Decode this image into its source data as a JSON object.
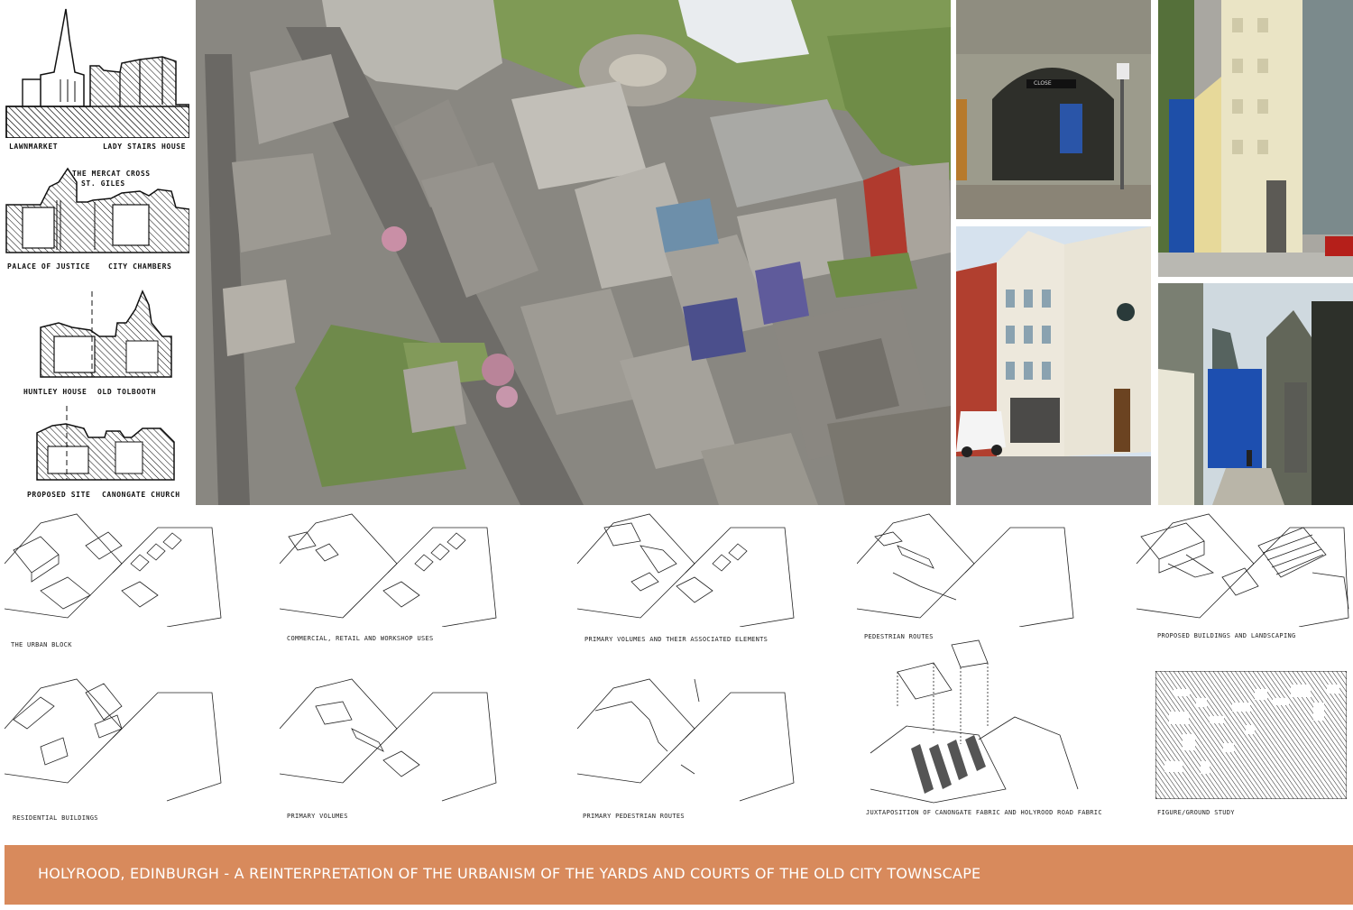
{
  "sketches": {
    "s1": {
      "left": "LAWNMARKET",
      "right": "LADY STAIRS HOUSE"
    },
    "s2": {
      "annotation_1": "THE MERCAT CROSS",
      "annotation_2": "ST. GILES",
      "left": "PALACE OF JUSTICE",
      "right": "CITY CHAMBERS"
    },
    "s3": {
      "left": "HUNTLEY HOUSE",
      "right": "OLD TOLBOOTH"
    },
    "s4": {
      "left": "PROPOSED SITE",
      "right": "CANONGATE CHURCH"
    }
  },
  "photos": {
    "close_sign": "CLOSE"
  },
  "diagrams": [
    {
      "caption": "THE URBAN BLOCK"
    },
    {
      "caption": "COMMERCIAL, RETAIL AND WORKSHOP USES"
    },
    {
      "caption": "PRIMARY VOLUMES AND THEIR ASSOCIATED ELEMENTS"
    },
    {
      "caption": "PEDESTRIAN ROUTES"
    },
    {
      "caption": "PROPOSED BUILDINGS AND LANDSCAPING"
    },
    {
      "caption": "RESIDENTIAL BUILDINGS"
    },
    {
      "caption": "PRIMARY VOLUMES"
    },
    {
      "caption": "PRIMARY PEDESTRIAN ROUTES"
    },
    {
      "caption": "JUXTAPOSITION OF CANONGATE FABRIC AND HOLYROOD ROAD FABRIC"
    },
    {
      "caption": "FIGURE/GROUND STUDY"
    }
  ],
  "banner": {
    "title": "HOLYROOD, EDINBURGH - A REINTERPRETATION OF THE URBANISM OF THE YARDS AND COURTS OF THE OLD CITY TOWNSCAPE",
    "color": "#d88a5c"
  }
}
